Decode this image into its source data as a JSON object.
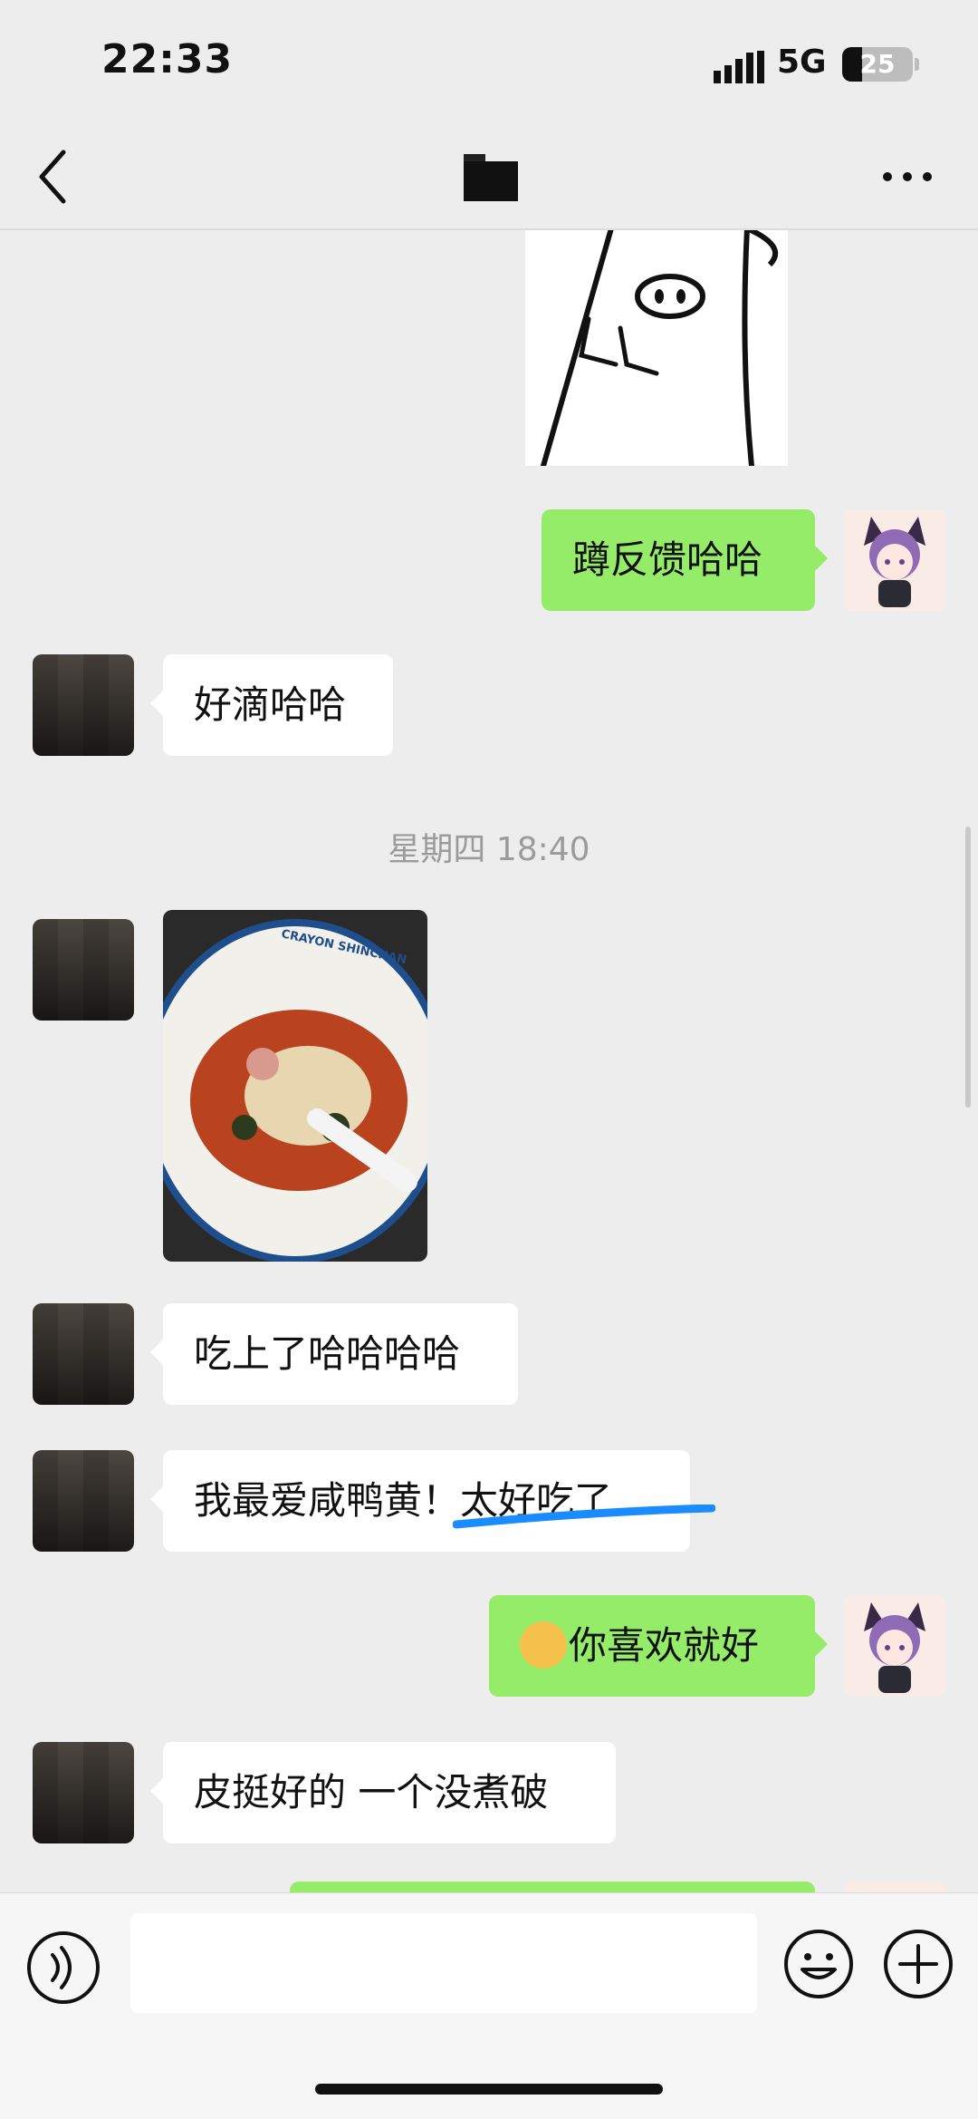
{
  "status": {
    "time": "22:33",
    "network": "5G",
    "battery": "25"
  },
  "nav": {
    "back_icon": "chevron-left-icon",
    "more_icon": "more-dots-icon"
  },
  "messages": {
    "m1": "蹲反馈哈哈",
    "m2": "好滴哈哈",
    "timestamp": "星期四 18:40",
    "photo_text": "CRAYON SHINCHAN",
    "m3": "吃上了哈哈哈哈",
    "m4": "我最爱咸鸭黄！太好吃了",
    "m5": "你喜欢就好",
    "m6": "皮挺好的 一个没煮破"
  },
  "colors": {
    "self_bubble": "#95ec69",
    "other_bubble": "#ffffff",
    "background": "#ededed",
    "underline": "#1a8cff"
  },
  "input": {
    "voice_icon": "voice-icon",
    "emoji_icon": "emoji-icon",
    "plus_icon": "plus-icon"
  }
}
